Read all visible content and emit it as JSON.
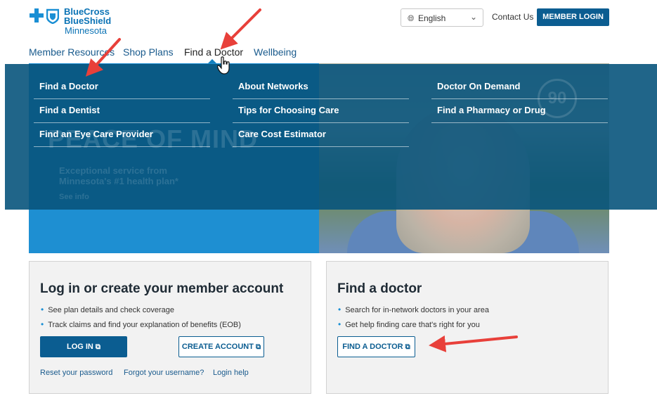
{
  "brand": {
    "line1": "BlueCross",
    "line2": "BlueShield",
    "line3": "Minnesota"
  },
  "header": {
    "language": "English",
    "contact": "Contact Us",
    "member_login": "MEMBER LOGIN"
  },
  "nav": {
    "items": [
      {
        "label": "Member Resources"
      },
      {
        "label": "Shop Plans"
      },
      {
        "label": "Find a Doctor"
      },
      {
        "label": "Wellbeing"
      }
    ]
  },
  "dropdown": {
    "col1": [
      "Find a Doctor",
      "Find a Dentist",
      "Find an Eye Care Provider"
    ],
    "col2": [
      "About Networks",
      "Tips for Choosing Care",
      "Care Cost Estimator"
    ],
    "col3": [
      "Doctor On Demand",
      "Find a Pharmacy or Drug"
    ]
  },
  "hero": {
    "headline": "PEACE OF MIND",
    "subline1": "Exceptional service from",
    "subline2": "Minnesota's #1 health plan*",
    "more": "See info",
    "badge": "90"
  },
  "account_card": {
    "title": "Log in or create your member account",
    "bullets": [
      "See plan details and check coverage",
      "Track claims and find your explanation of benefits (EOB)"
    ],
    "login_button": "LOG IN",
    "create_button": "CREATE ACCOUNT",
    "links": [
      "Reset your password",
      "Forgot your username?",
      "Login help"
    ]
  },
  "doctor_card": {
    "title": "Find a doctor",
    "bullets": [
      "Search for in-network doctors in your area",
      "Get help finding care that's right for you"
    ],
    "button": "FIND A DOCTOR"
  },
  "icons": {
    "external": "external-link-icon",
    "globe": "globe-icon",
    "chevron": "chevron-down-icon"
  },
  "colors": {
    "primary": "#0b5d91",
    "brand_blue": "#1a8fd4",
    "dropdown_bg": "#08547c",
    "annotation_arrow": "#e8403a"
  }
}
